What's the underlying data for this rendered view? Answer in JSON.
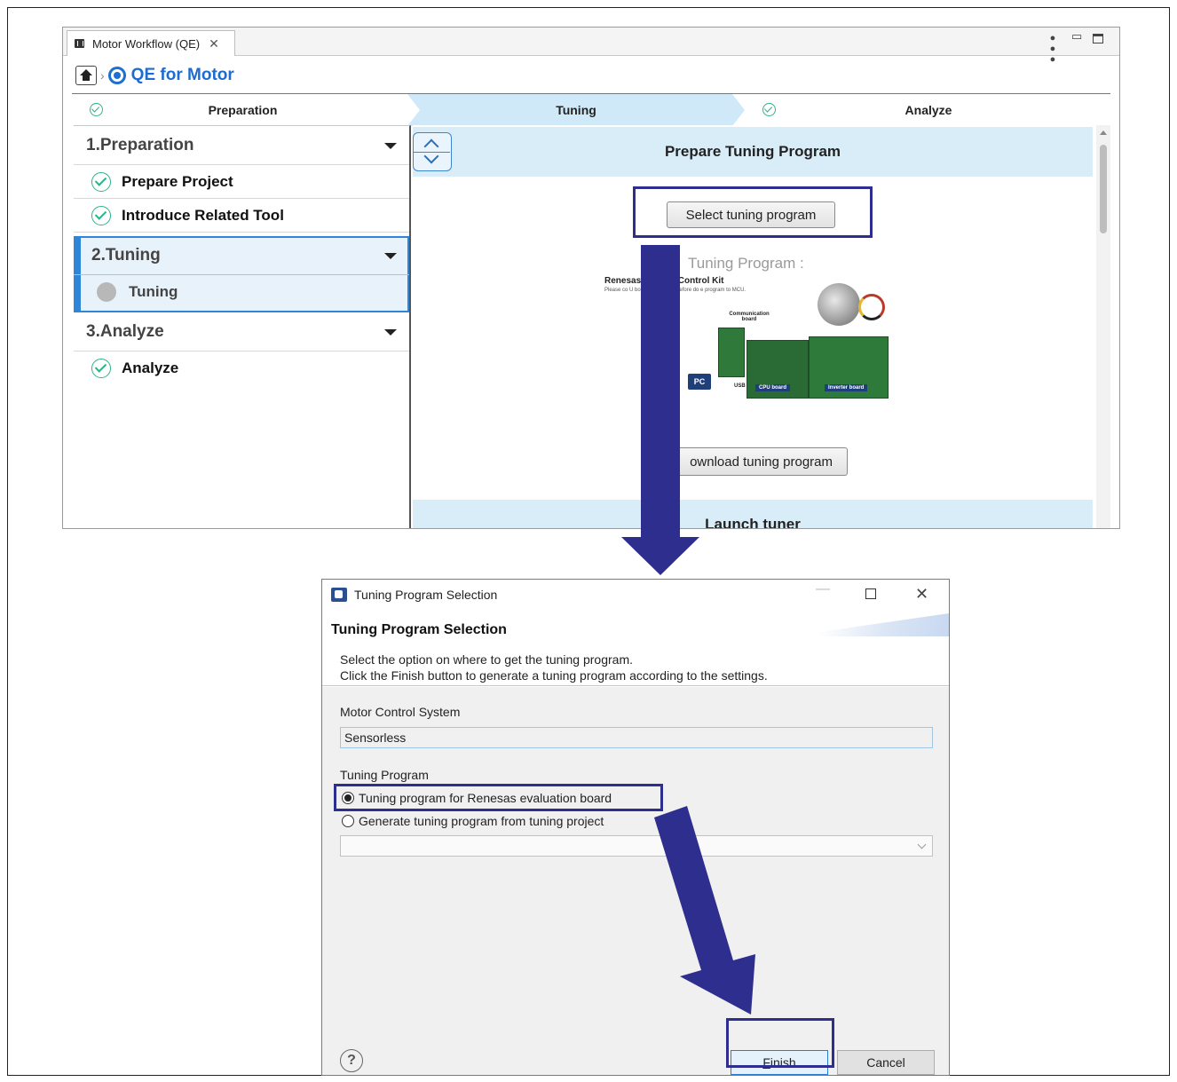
{
  "workflow": {
    "tab_label": "Motor Workflow (QE)",
    "breadcrumb_title": "QE for Motor",
    "steps": [
      {
        "label": "Preparation",
        "done": true
      },
      {
        "label": "Tuning",
        "active": true
      },
      {
        "label": "Analyze",
        "done": true
      }
    ],
    "sidebar": {
      "sections": [
        {
          "title": "1.Preparation",
          "items": [
            "Prepare Project",
            "Introduce Related Tool"
          ]
        },
        {
          "title": "2.Tuning",
          "items": [
            "Tuning"
          ]
        },
        {
          "title": "3.Analyze",
          "items": [
            "Analyze"
          ]
        }
      ]
    },
    "panel": {
      "prepare_heading": "Prepare Tuning Program",
      "select_button": "Select tuning program",
      "ghost_text": "Tuning Program :",
      "kit_title": "Renesas          e Motor Control Kit",
      "kit_note": "Please co          U board to your PC before do         e program to MCU.",
      "comm_board_label": "Communication board",
      "pc_label": "PC",
      "usb_label": "USB",
      "cpu_board_label": "CPU board",
      "inverter_board_label": "Inverter board",
      "download_button": "ownload tuning program",
      "launch_heading": "Launch tuner"
    }
  },
  "dialog": {
    "title": "Tuning Program Selection",
    "heading": "Tuning Program Selection",
    "desc_line1": "Select the option on where to get the tuning program.",
    "desc_line2": "Click the Finish button to generate a tuning program according to the settings.",
    "motor_label": "Motor Control System",
    "motor_value": "Sensorless",
    "program_label": "Tuning Program",
    "option1": "Tuning program for Renesas evaluation board",
    "option2": "Generate tuning program from tuning project",
    "selected_option": 1,
    "help_glyph": "?",
    "finish_mnemonic": "F",
    "finish_rest": "inish",
    "cancel_label": "Cancel"
  },
  "colors": {
    "annotation": "#2e2e8e",
    "step_active": "#cfe9f9",
    "check_green": "#2ab389",
    "link_blue": "#1d6ccf"
  }
}
